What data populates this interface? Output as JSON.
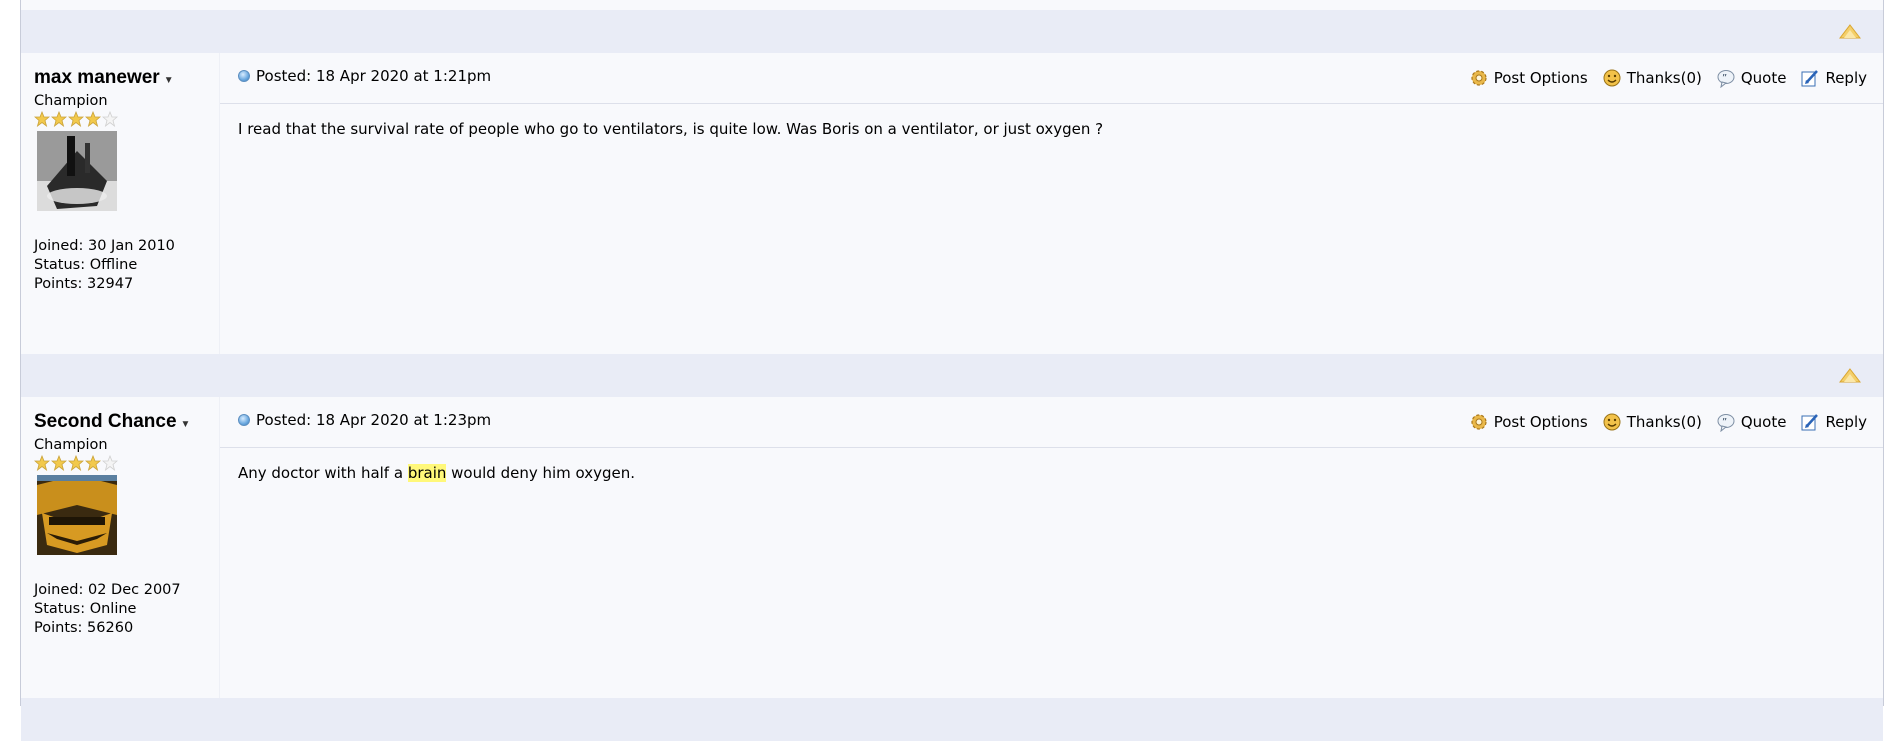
{
  "posts": [
    {
      "username": "max manewer",
      "rank": "Champion",
      "stars_filled": 4,
      "stars_total": 5,
      "joined": "Joined: 30 Jan 2010",
      "status": "Status: Offline",
      "points": "Points: 32947",
      "posted": "Posted: 18 Apr 2020 at 1:21pm",
      "actions": {
        "options": "Post Options",
        "thanks": "Thanks(0)",
        "quote": "Quote",
        "reply": "Reply"
      },
      "message_before": "I read that the survival rate of people who go to ventilators, is quite low. Was Boris on a ventilator, or just oxygen ?",
      "message_highlight": "",
      "message_after": ""
    },
    {
      "username": "Second Chance",
      "rank": "Champion",
      "stars_filled": 4,
      "stars_total": 5,
      "joined": "Joined: 02 Dec 2007",
      "status": "Status: Online",
      "points": "Points: 56260",
      "posted": "Posted: 18 Apr 2020 at 1:23pm",
      "actions": {
        "options": "Post Options",
        "thanks": "Thanks(0)",
        "quote": "Quote",
        "reply": "Reply"
      },
      "message_before": "Any doctor with half a ",
      "message_highlight": "brain",
      "message_after": " would deny him oxygen."
    }
  ],
  "colors": {
    "separator": "#e9ecf6",
    "background": "#f8f9fc",
    "highlight": "#fff87a",
    "star": "#f2c94c"
  },
  "icons": [
    "back-to-top-icon",
    "status-dot-icon",
    "gear-icon",
    "smiley-icon",
    "quote-icon",
    "reply-icon",
    "star-icon"
  ]
}
